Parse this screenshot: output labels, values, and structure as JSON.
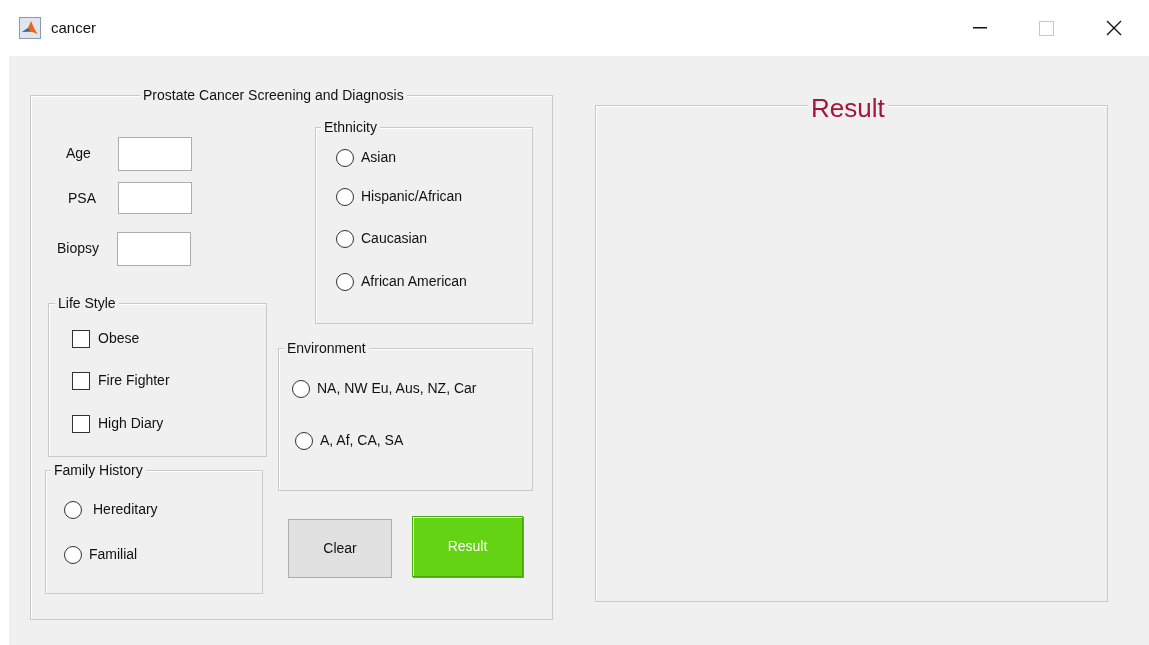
{
  "window": {
    "title": "cancer"
  },
  "main_panel": {
    "title": "Prostate Cancer Screening and Diagnosis"
  },
  "fields": [
    {
      "label": "Age"
    },
    {
      "label": "PSA"
    },
    {
      "label": "Biopsy"
    }
  ],
  "ethnicity": {
    "title": "Ethnicity",
    "options": [
      {
        "label": "Asian",
        "selected": false
      },
      {
        "label": "Hispanic/African",
        "selected": false
      },
      {
        "label": "Caucasian",
        "selected": false
      },
      {
        "label": "African American",
        "selected": false
      }
    ]
  },
  "life_style": {
    "title": "Life Style",
    "options": [
      {
        "label": "Obese",
        "checked": false
      },
      {
        "label": "Fire Fighter",
        "checked": false
      },
      {
        "label": "High Diary",
        "checked": false
      }
    ]
  },
  "family_history": {
    "title": "Family History",
    "options": [
      {
        "label": "Hereditary",
        "selected": false
      },
      {
        "label": "Familial",
        "selected": false
      }
    ]
  },
  "environment": {
    "title": "Environment",
    "options": [
      {
        "label": "NA, NW Eu, Aus, NZ, Car",
        "selected": false
      },
      {
        "label": "A, Af, CA, SA",
        "selected": false
      }
    ]
  },
  "buttons": [
    {
      "label": "Clear",
      "kind": "default"
    },
    {
      "label": "Result",
      "kind": "primary"
    }
  ],
  "result_panel": {
    "title": "Result"
  }
}
